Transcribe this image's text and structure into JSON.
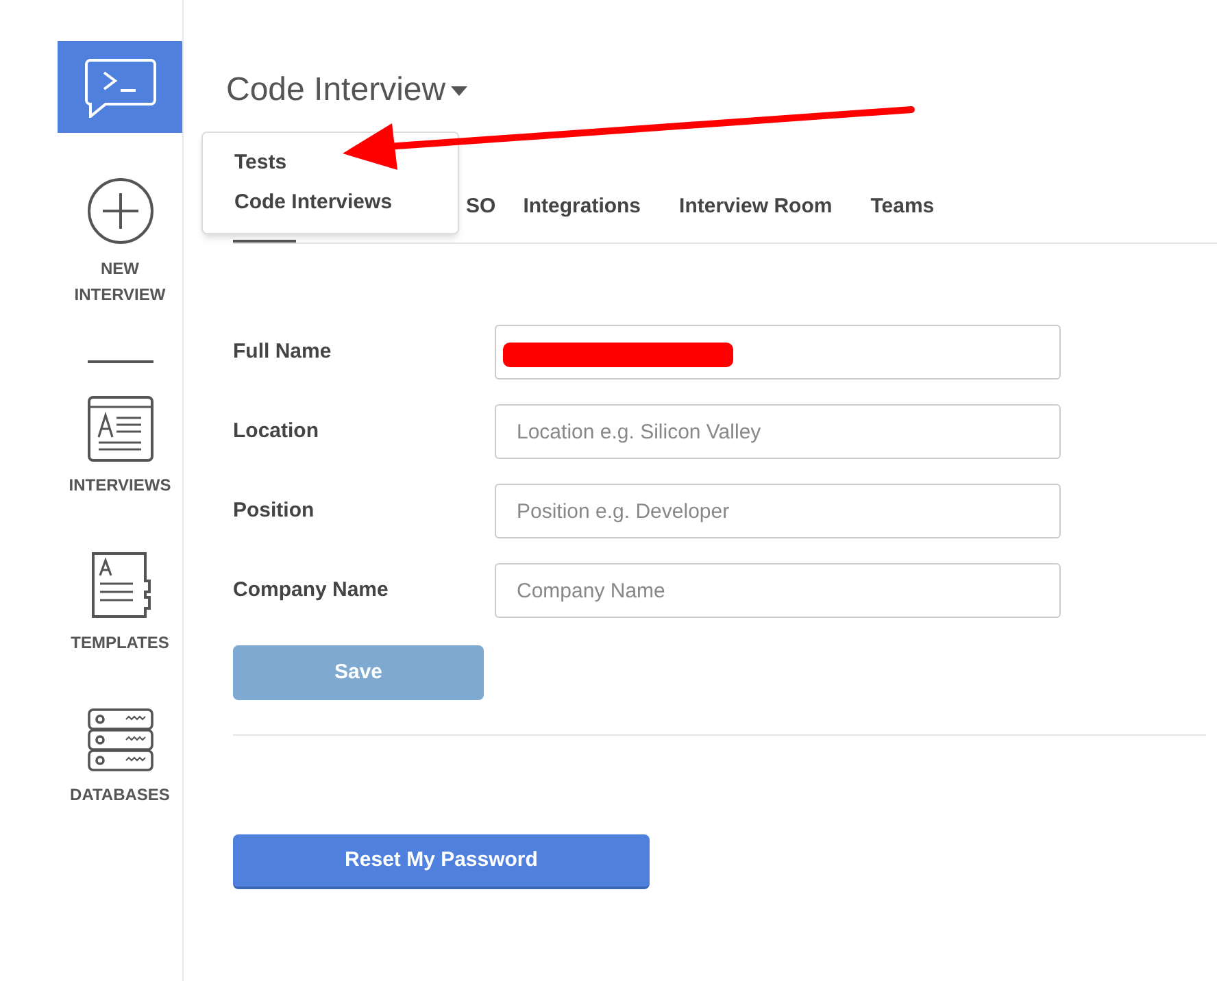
{
  "sidebar": {
    "items": [
      {
        "kind": "new",
        "label": "NEW INTERVIEW"
      },
      {
        "kind": "interviews",
        "label": "INTERVIEWS"
      },
      {
        "kind": "templates",
        "label": "TEMPLATES"
      },
      {
        "kind": "databases",
        "label": "DATABASES"
      }
    ]
  },
  "header": {
    "title": "Code Interview"
  },
  "dropdown": {
    "items": [
      "Tests",
      "Code Interviews"
    ]
  },
  "tabs": [
    {
      "selected": true
    },
    {
      "label": "SO",
      "selected": false
    },
    {
      "label": "Integrations",
      "selected": false
    },
    {
      "label": "Interview Room",
      "selected": false
    },
    {
      "label": "Teams",
      "selected": false
    }
  ],
  "form": {
    "fields": [
      {
        "label": "Full Name",
        "redacted": true
      },
      {
        "label": "Location",
        "placeholder": "Location e.g. Silicon Valley"
      },
      {
        "label": "Position",
        "placeholder": "Position e.g. Developer"
      },
      {
        "label": "Company Name",
        "placeholder": "Company Name"
      }
    ],
    "save_button": {
      "label": "Save",
      "disabled": true
    }
  },
  "reset_button": "Reset My Password",
  "annotation": {
    "kind": "arrow"
  }
}
